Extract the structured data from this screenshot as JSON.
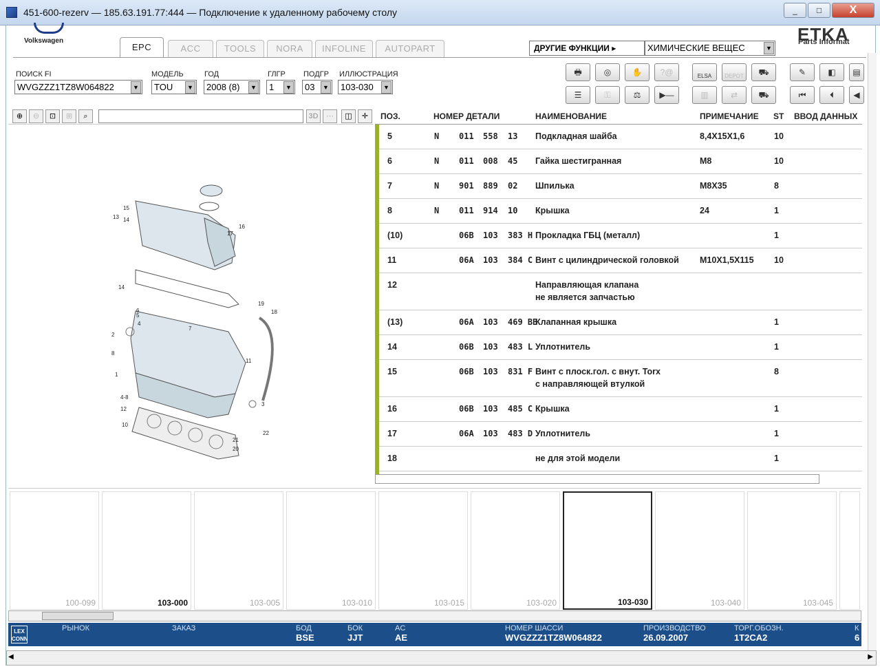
{
  "window": {
    "title": "451-600-rezerv — 185.63.191.77:444 — Подключение к удаленному рабочему столу",
    "min": "_",
    "max": "□",
    "close": "X"
  },
  "brand": {
    "vw": "Volkswagen",
    "etka": "ETKA",
    "etka_sub": "Parts Informat"
  },
  "tabs": [
    "EPC",
    "ACC",
    "TOOLS",
    "NORA",
    "INFOLINE",
    "AUTOPART"
  ],
  "other_functions": {
    "label": "ДРУГИЕ ФУНКЦИИ ▸",
    "value": "ХИМИЧЕСКИЕ ВЕЩЕС"
  },
  "fields": [
    {
      "label": "ПОИСК FI",
      "value": "WVGZZZ1TZ8W064822"
    },
    {
      "label": "МОДЕЛЬ",
      "value": "TOU"
    },
    {
      "label": "ГОД",
      "value": "2008 (8)"
    },
    {
      "label": "ГЛГР",
      "value": "1"
    },
    {
      "label": "ПОДГР",
      "value": "03"
    },
    {
      "label": "ИЛЛЮСТРАЦИЯ",
      "value": "103-030"
    }
  ],
  "toolbar_icons": {
    "elsa": "ELSA",
    "depot": "DEPOT"
  },
  "zoom": {
    "btn3d": "3D"
  },
  "table": {
    "headers": [
      "ПОЗ.",
      "НОМЕР ДЕТАЛИ",
      "НАИМЕНОВАНИЕ",
      "ПРИМЕЧАНИЕ",
      "ST",
      "ВВОД ДАННЫХ"
    ],
    "rows": [
      {
        "pos": "5",
        "flag": "N",
        "p1": "011",
        "p2": "558",
        "p3": "13",
        "name": "Подкладная шайба",
        "name2": "",
        "note": "8,4X15X1,6",
        "st": "10"
      },
      {
        "pos": "6",
        "flag": "N",
        "p1": "011",
        "p2": "008",
        "p3": "45",
        "name": "Гайка шестигранная",
        "name2": "",
        "note": "M8",
        "st": "10"
      },
      {
        "pos": "7",
        "flag": "N",
        "p1": "901",
        "p2": "889",
        "p3": "02",
        "name": "Шпилька",
        "name2": "",
        "note": "M8X35",
        "st": "8"
      },
      {
        "pos": "8",
        "flag": "N",
        "p1": "011",
        "p2": "914",
        "p3": "10",
        "name": "Крышка",
        "name2": "",
        "note": "24",
        "st": "1"
      },
      {
        "pos": "(10)",
        "flag": "",
        "p1": "06B",
        "p2": "103",
        "p3": "383 H",
        "name": "Прокладка ГБЦ (металл)",
        "name2": "",
        "note": "",
        "st": "1"
      },
      {
        "pos": "11",
        "flag": "",
        "p1": "06A",
        "p2": "103",
        "p3": "384 C",
        "name": "Винт с цилиндрической головкой",
        "name2": "",
        "note": "M10X1,5X115",
        "st": "10"
      },
      {
        "pos": "12",
        "flag": "",
        "p1": "",
        "p2": "",
        "p3": "",
        "name": "Направляющая клапана",
        "name2": "не является запчастью",
        "note": "",
        "st": ""
      },
      {
        "pos": "(13)",
        "flag": "",
        "p1": "06A",
        "p2": "103",
        "p3": "469 BB",
        "name": "Клапанная крышка",
        "name2": "",
        "note": "",
        "st": "1"
      },
      {
        "pos": "14",
        "flag": "",
        "p1": "06B",
        "p2": "103",
        "p3": "483 L",
        "name": "Уплотнитель",
        "name2": "",
        "note": "",
        "st": "1"
      },
      {
        "pos": "15",
        "flag": "",
        "p1": "06B",
        "p2": "103",
        "p3": "831 F",
        "name": "Винт с плоск.гол. с внут. Torx",
        "name2": "с направляющей втулкой",
        "note": "",
        "st": "8"
      },
      {
        "pos": "16",
        "flag": "",
        "p1": "06B",
        "p2": "103",
        "p3": "485 C",
        "name": "Крышка",
        "name2": "",
        "note": "",
        "st": "1"
      },
      {
        "pos": "17",
        "flag": "",
        "p1": "06A",
        "p2": "103",
        "p3": "483 D",
        "name": "Уплотнитель",
        "name2": "",
        "note": "",
        "st": "1"
      },
      {
        "pos": "18",
        "flag": "",
        "p1": "",
        "p2": "",
        "p3": "",
        "name": "не для этой модели",
        "name2": "",
        "note": "",
        "st": "1"
      }
    ]
  },
  "callouts": [
    "15",
    "13",
    "14",
    "16",
    "17",
    "14",
    "19",
    "18",
    "6",
    "5",
    "4",
    "7",
    "2",
    "8",
    "11",
    "1",
    "4-8",
    "12",
    "3",
    "10",
    "21",
    "22",
    "20"
  ],
  "thumbnails": [
    "100-099",
    "103-000",
    "103-005",
    "103-010",
    "103-015",
    "103-020",
    "103-030",
    "103-040",
    "103-045"
  ],
  "status": {
    "logo": "LEX CONN",
    "items": [
      {
        "label": "РЫНОК",
        "value": ""
      },
      {
        "label": "ЗАКАЗ",
        "value": ""
      },
      {
        "label": "БОД",
        "value": "BSE"
      },
      {
        "label": "БОК",
        "value": "JJT"
      },
      {
        "label": "AC",
        "value": "AE"
      },
      {
        "label": "НОМЕР ШАССИ",
        "value": "WVGZZZ1TZ8W064822"
      },
      {
        "label": "ПРОИЗВОДСТВО",
        "value": "26.09.2007"
      },
      {
        "label": "ТОРГ.ОБОЗН.",
        "value": "1T2CA2"
      },
      {
        "label": "К",
        "value": "6"
      }
    ]
  }
}
